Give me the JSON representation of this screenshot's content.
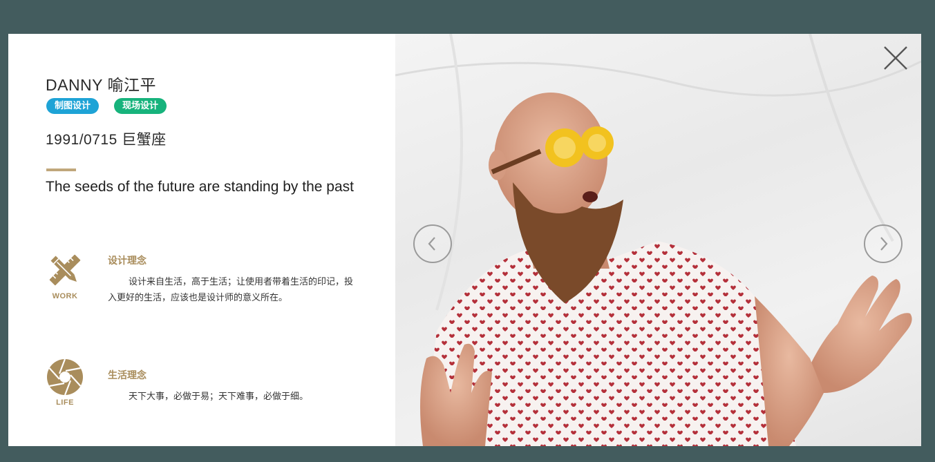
{
  "profile": {
    "name": "DANNY 喻江平",
    "tags": [
      "制图设计",
      "现场设计"
    ],
    "birth": "1991/0715  巨蟹座",
    "motto": "The seeds of the future are standing by the past"
  },
  "sections": [
    {
      "icon": "pencil-ruler-icon",
      "icon_caption": "WORK",
      "title": "设计理念",
      "text": "设计来自生活，高于生活；让使用者带着生活的印记，投入更好的生活，应该也是设计师的意义所在。"
    },
    {
      "icon": "camera-aperture-icon",
      "icon_caption": "LIFE",
      "title": "生活理念",
      "text": "天下大事，必做于易；天下难事，必做于细。"
    }
  ],
  "colors": {
    "background": "#435c5e",
    "accent_gold": "#a98d5c",
    "tag_blue": "#1ea3d6",
    "tag_green": "#17b37c"
  },
  "controls": {
    "prev_icon": "chevron-left-icon",
    "next_icon": "chevron-right-icon",
    "close_icon": "close-icon"
  }
}
